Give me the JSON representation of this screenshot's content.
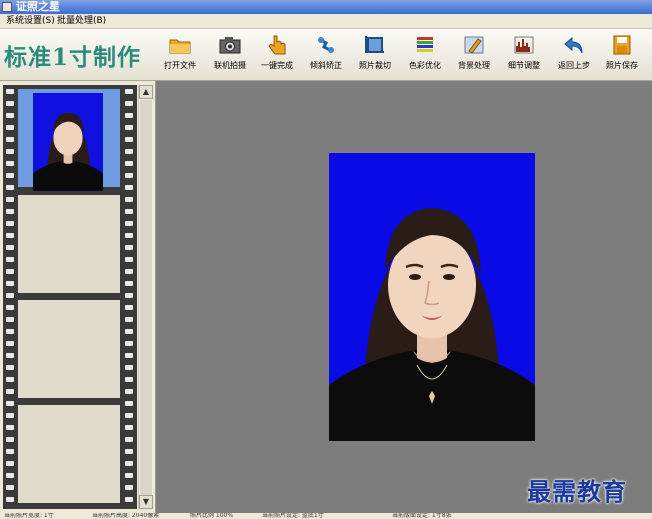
{
  "window": {
    "title": "证照之星"
  },
  "menu": {
    "items": [
      "系统设置(S)",
      "批量处理(B)"
    ]
  },
  "toolbar": {
    "mode_title": "标准1寸制作",
    "buttons": [
      {
        "label": "打开文件",
        "icon": "folder-icon"
      },
      {
        "label": "联机拍摄",
        "icon": "camera-icon"
      },
      {
        "label": "一键完成",
        "icon": "hand-pointer-icon"
      },
      {
        "label": "倾斜矫正",
        "icon": "rotate-correct-icon"
      },
      {
        "label": "照片裁切",
        "icon": "crop-icon"
      },
      {
        "label": "色彩优化",
        "icon": "color-bars-icon"
      },
      {
        "label": "背景处理",
        "icon": "background-brush-icon"
      },
      {
        "label": "细节调整",
        "icon": "histogram-icon"
      },
      {
        "label": "返回上步",
        "icon": "undo-arrow-icon"
      },
      {
        "label": "照片保存",
        "icon": "floppy-disk-icon"
      }
    ]
  },
  "filmstrip": {
    "frames": 4,
    "selected": 0
  },
  "status": {
    "items": [
      "当前照片宽度: 1寸",
      "当前照片高度: 2040像素",
      "照片比例 100%",
      "当前照片设定: 蓝底1寸",
      "当前版面设定: 1寸8张"
    ]
  },
  "watermark": {
    "text": "最需教育"
  },
  "colors": {
    "photo_background": "#0a0ae6",
    "title_accent": "#2d8a7e",
    "selected_frame": "#6f9be0"
  }
}
